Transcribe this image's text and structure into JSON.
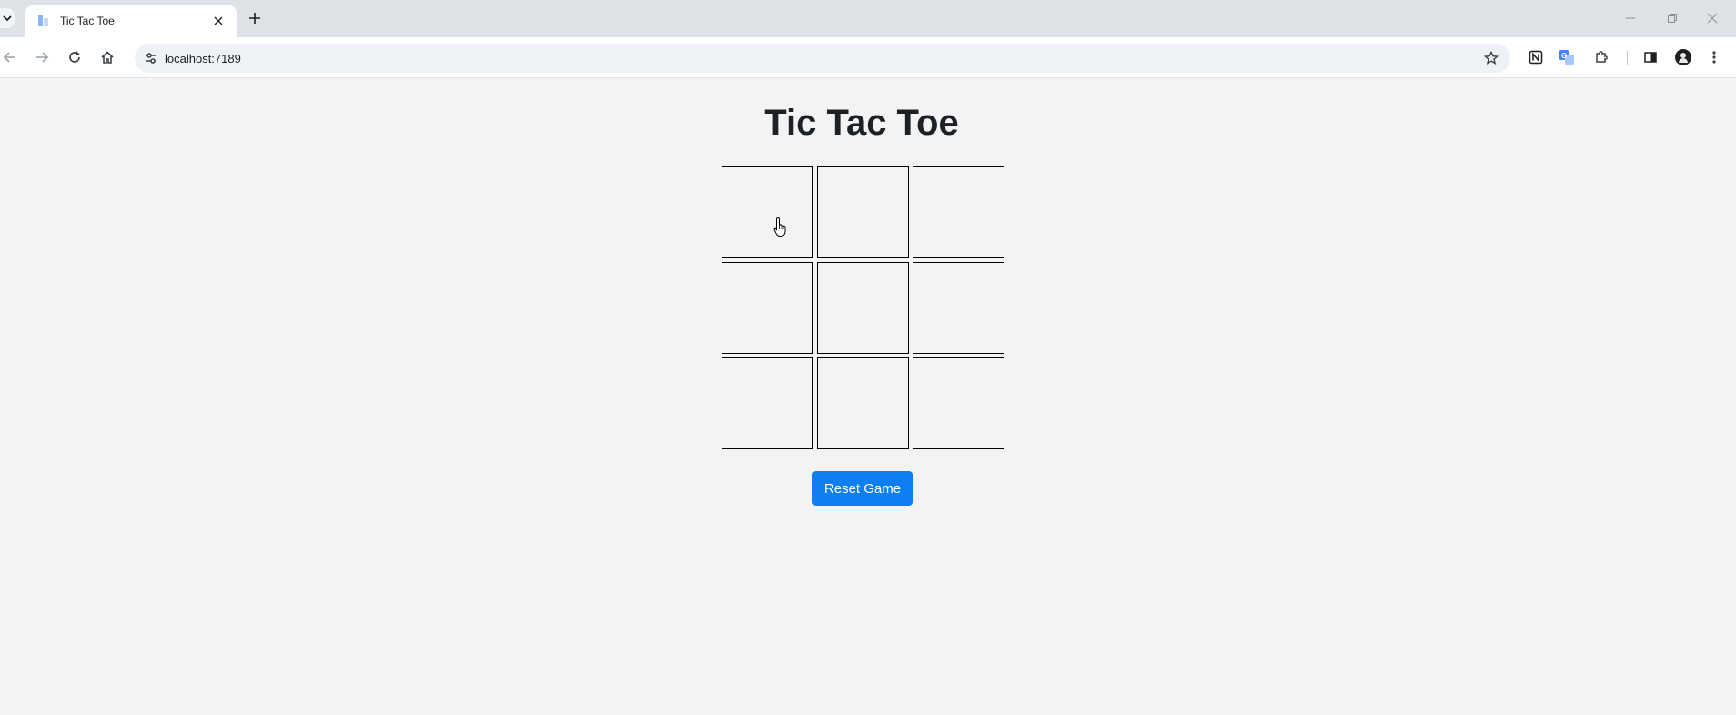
{
  "browser": {
    "tab_title": "Tic Tac Toe",
    "url": "localhost:7189",
    "icons": {
      "tab_search": "chevron-down-icon",
      "favicon": "favicon-icon",
      "tab_close": "close-icon",
      "new_tab": "plus-icon",
      "back": "back-arrow-icon",
      "forward": "forward-arrow-icon",
      "reload": "reload-icon",
      "home": "home-icon",
      "site_info": "tune-icon",
      "bookmark": "star-icon",
      "notion": "notion-icon",
      "translate": "translate-icon",
      "extensions": "puzzle-icon",
      "side_panel": "side-panel-icon",
      "profile": "avatar",
      "menu": "kebab-menu-icon"
    }
  },
  "game": {
    "title": "Tic Tac Toe",
    "board": [
      "",
      "",
      "",
      "",
      "",
      "",
      "",
      "",
      ""
    ],
    "reset_label": "Reset Game"
  },
  "colors": {
    "accent": "#0d7ff2",
    "title_text": "#1d2125",
    "page_bg": "#f3f3f3"
  }
}
